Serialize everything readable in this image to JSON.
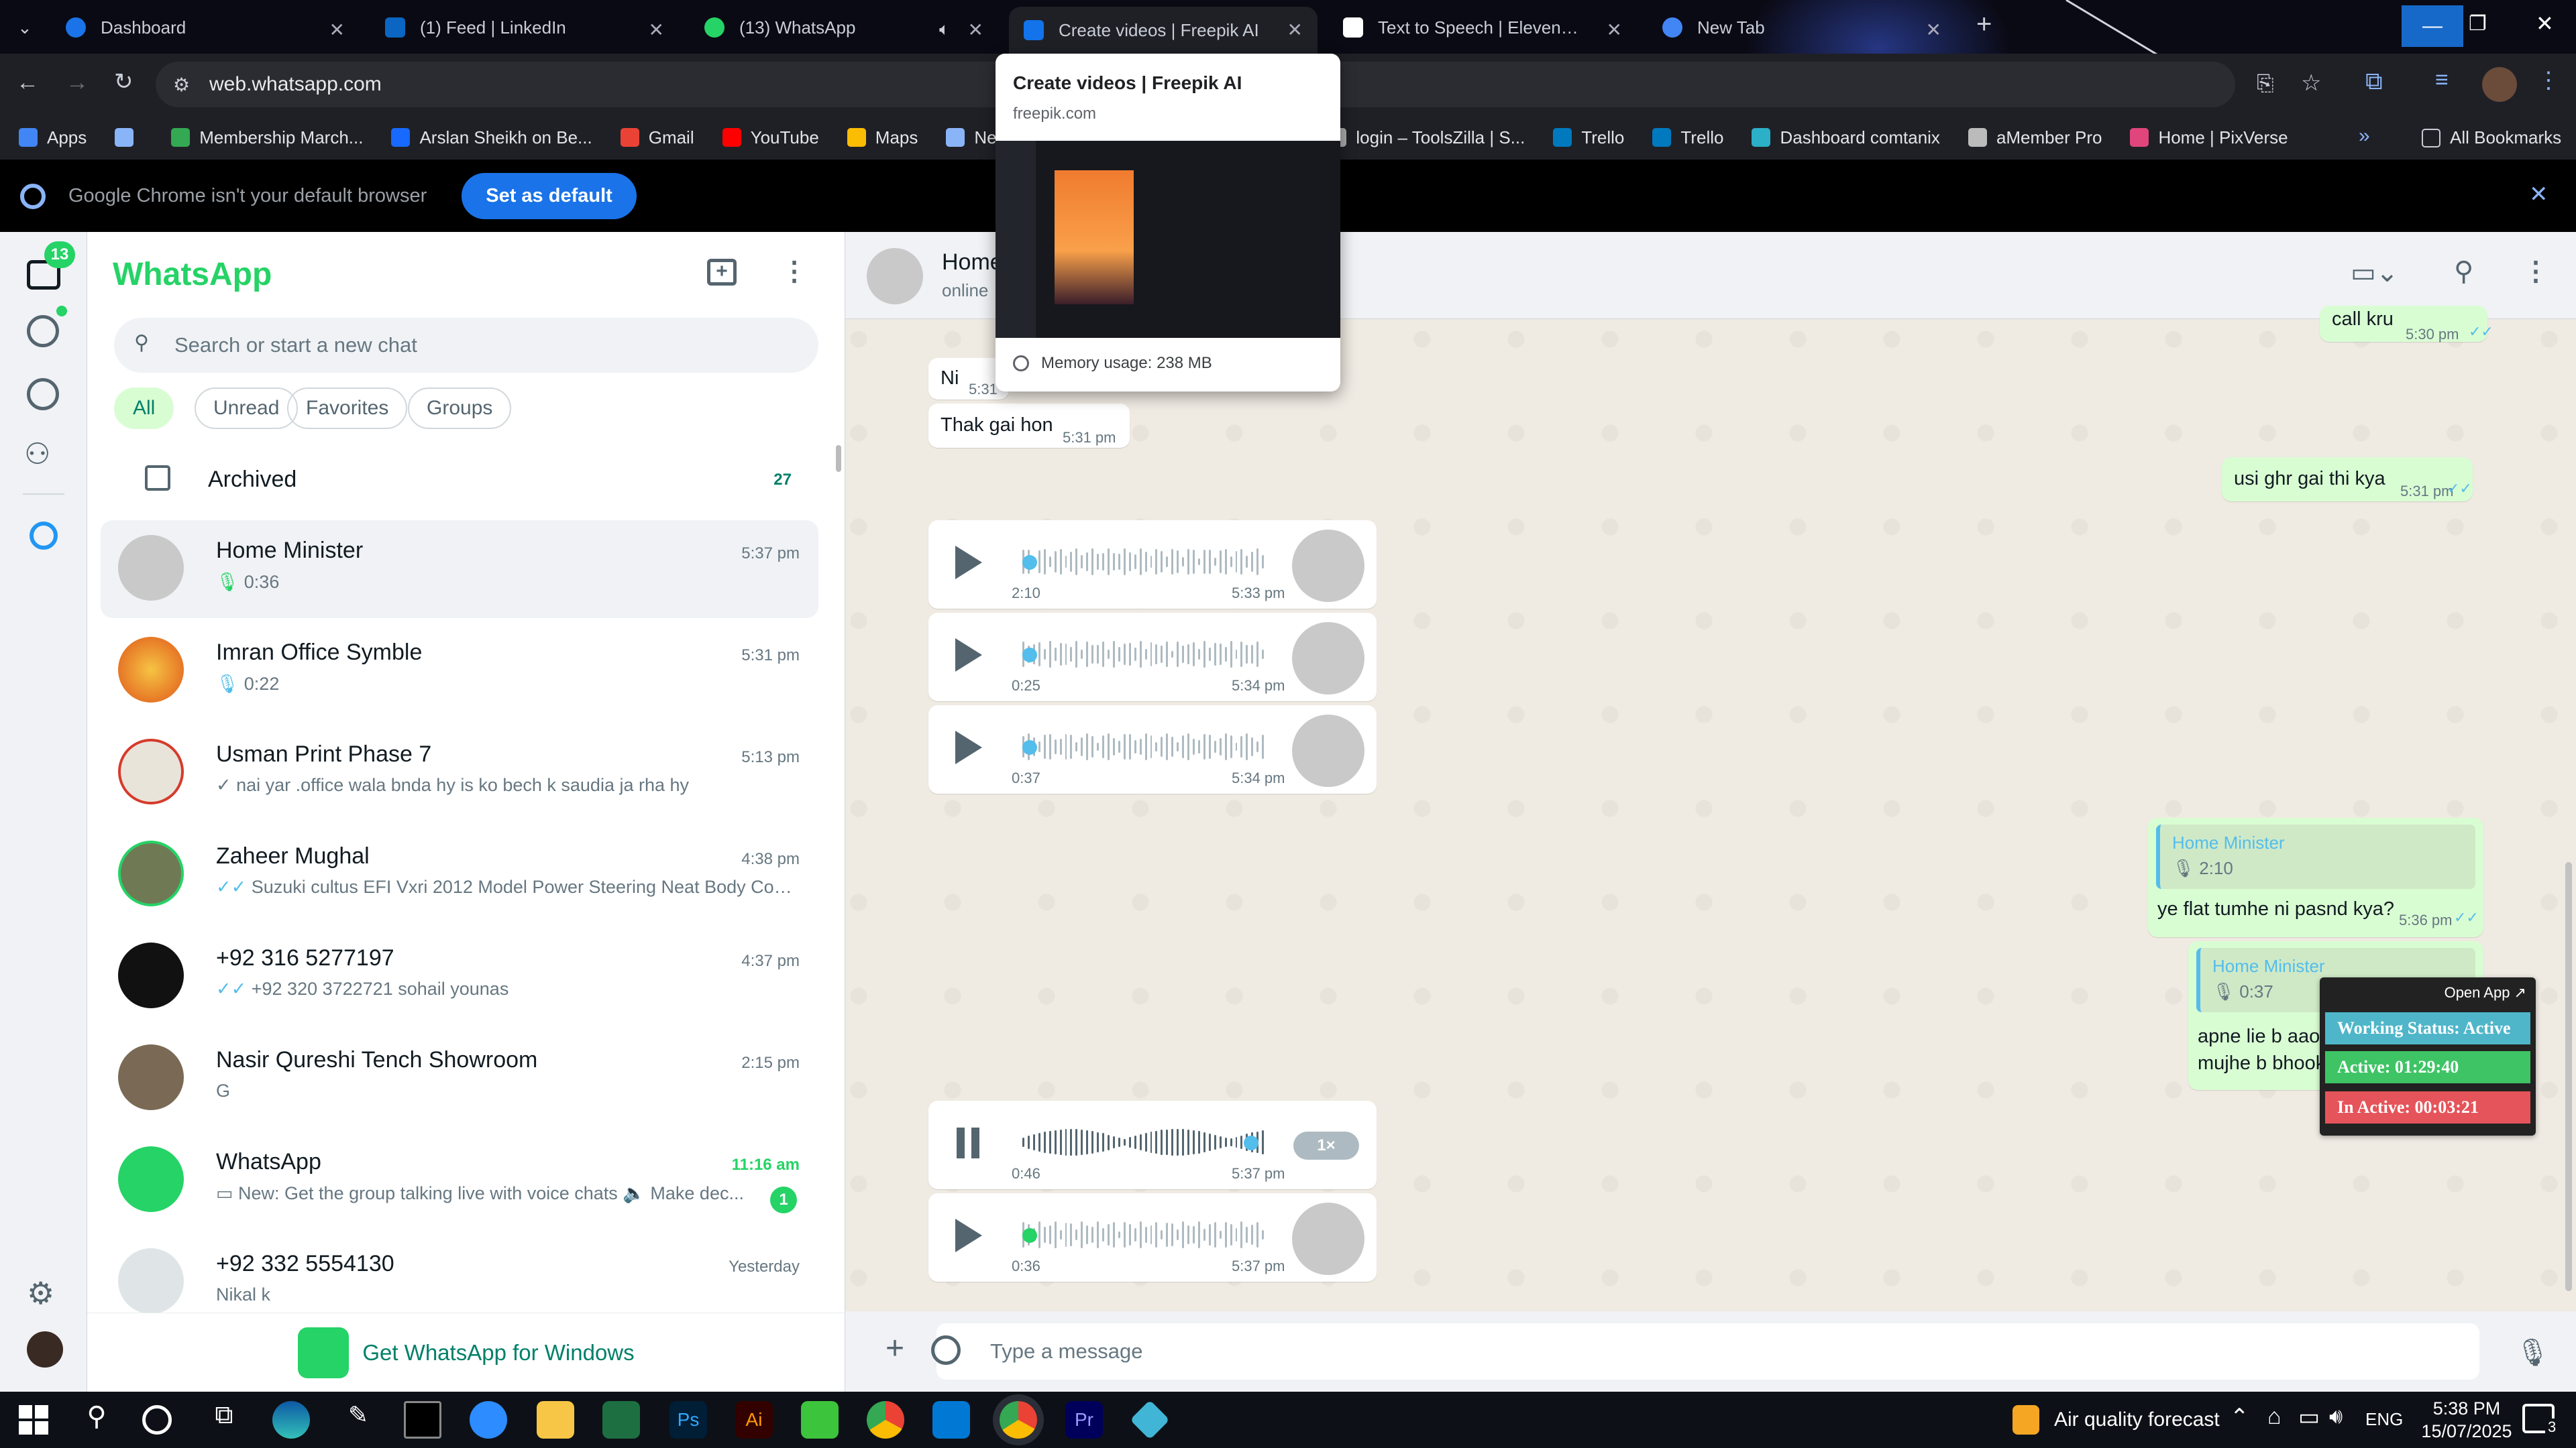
{
  "browser": {
    "tabs": [
      {
        "title": "Dashboard",
        "favicon": "globe-icon",
        "color": "#1a73e8"
      },
      {
        "title": "(1) Feed | LinkedIn",
        "favicon": "linkedin-icon",
        "color": "#0a66c2"
      },
      {
        "title": "(13) WhatsApp",
        "favicon": "whatsapp-icon",
        "color": "#25d366"
      },
      {
        "title": "Create videos | Freepik AI",
        "favicon": "freepik-icon",
        "color": "#1273eb"
      },
      {
        "title": "Text to Speech | ElevenLabs",
        "favicon": "elevenlabs-icon",
        "color": "#ffffff"
      },
      {
        "title": "New Tab",
        "favicon": "chrome-icon",
        "color": "#4285f4"
      }
    ],
    "url": "web.whatsapp.com",
    "bookmarks": [
      {
        "label": "Apps",
        "color": "#4285f4"
      },
      {
        "label": "",
        "color": "#8ab4f8"
      },
      {
        "label": "Membership March...",
        "color": "#34a853"
      },
      {
        "label": "Arslan Sheikh on Be...",
        "color": "#1769ff"
      },
      {
        "label": "Gmail",
        "color": "#ea4335"
      },
      {
        "label": "YouTube",
        "color": "#ff0000"
      },
      {
        "label": "Maps",
        "color": "#fbbc04"
      },
      {
        "label": "News",
        "color": "#8ab4f8"
      },
      {
        "label": "login – ToolsZilla | S...",
        "color": "#aaaaaa"
      },
      {
        "label": "Trello",
        "color": "#0079bf"
      },
      {
        "label": "Trello",
        "color": "#0079bf"
      },
      {
        "label": "Dashboard comtanix",
        "color": "#2bb0c8"
      },
      {
        "label": "aMember Pro",
        "color": "#bbbbbb"
      },
      {
        "label": "Home | PixVerse",
        "color": "#e0457b"
      }
    ],
    "all_bookmarks": "All Bookmarks",
    "infobar_text": "Google Chrome isn't your default browser",
    "set_default": "Set as default",
    "hovercard": {
      "title": "Create videos | Freepik AI",
      "domain": "freepik.com",
      "memory": "Memory usage: 238 MB"
    }
  },
  "whatsapp": {
    "app_title": "WhatsApp",
    "unread_badge": "13",
    "search_placeholder": "Search or start a new chat",
    "filters": [
      "All",
      "Unread",
      "Favorites",
      "Groups"
    ],
    "archived": {
      "label": "Archived",
      "count": "27"
    },
    "chats": [
      {
        "name": "Home Minister",
        "time": "5:37 pm",
        "preview": "0:36",
        "type": "voice",
        "avatar": "#c9c9c9"
      },
      {
        "name": "Imran Office Symble",
        "time": "5:31 pm",
        "preview": "0:22",
        "type": "voice",
        "avatar": "#e0a12a"
      },
      {
        "name": "Usman Print Phase 7",
        "time": "5:13 pm",
        "preview": "nai yar .office wala bnda hy  is ko bech k saudia ja rha hy",
        "type": "sent",
        "avatar": "#d9d9d9"
      },
      {
        "name": "Zaheer Mughal",
        "time": "4:38 pm",
        "preview": "Suzuki cultus EFI Vxri 2012 Model Power Steering Neat Body Con...",
        "type": "read",
        "avatar": "#6f7a55"
      },
      {
        "name": "+92 316 5277197",
        "time": "4:37 pm",
        "preview": "+92 320 3722721  sohail younas",
        "type": "read",
        "avatar": "#111111"
      },
      {
        "name": "Nasir Qureshi Tench Showroom",
        "time": "2:15 pm",
        "preview": "G",
        "type": "text",
        "avatar": "#7a6a55"
      },
      {
        "name": "WhatsApp",
        "time": "11:16 am",
        "preview": "New: Get the group talking live with voice chats 🔈 Make dec...",
        "type": "video",
        "avatar": "#25d366",
        "badge": "1"
      },
      {
        "name": "+92 332 5554130",
        "time": "Yesterday",
        "preview": "Nikal k",
        "type": "text",
        "avatar": "#dfe5e7"
      }
    ],
    "get_windows": "Get WhatsApp for Windows",
    "conversation": {
      "contact": "Home Minister",
      "status": "online",
      "messages": {
        "m_top": {
          "text": "call kru",
          "time": "5:30 pm"
        },
        "m_ni": {
          "text": "Ni",
          "time": "5:31 pm"
        },
        "m_thak": {
          "text": "Thak gai hon",
          "time": "5:31 pm"
        },
        "m_usi": {
          "text": "usi ghr gai thi kya",
          "time": "5:31 pm"
        },
        "v1": {
          "duration": "2:10",
          "time": "5:33 pm"
        },
        "v2": {
          "duration": "0:25",
          "time": "5:34 pm"
        },
        "v3": {
          "duration": "0:37",
          "time": "5:34 pm"
        },
        "q1": {
          "author": "Home Minister",
          "quoted": "2:10",
          "text": "ye flat tumhe ni pasnd kya?",
          "time": "5:36 pm"
        },
        "q2": {
          "author": "Home Minister",
          "quoted": "0:37",
          "text1": "apne lie b aao",
          "text2": "mujhe b bhook shadid"
        },
        "v4": {
          "duration": "0:46",
          "time": "5:37 pm",
          "speed": "1×"
        },
        "v5": {
          "duration": "0:36",
          "time": "5:37 pm"
        }
      },
      "composer_placeholder": "Type a message"
    }
  },
  "widget": {
    "open_app": "Open App ↗",
    "status": "Working Status: Active",
    "active": "Active: 01:29:40",
    "inactive": "In Active: 00:03:21",
    "colors": {
      "status": "#4fb6c9",
      "active": "#3ec465",
      "inactive": "#e5545a"
    }
  },
  "taskbar": {
    "weather": "Air quality forecast",
    "lang": "ENG",
    "time": "5:38 PM",
    "date": "15/07/2025",
    "notifications": "3"
  }
}
